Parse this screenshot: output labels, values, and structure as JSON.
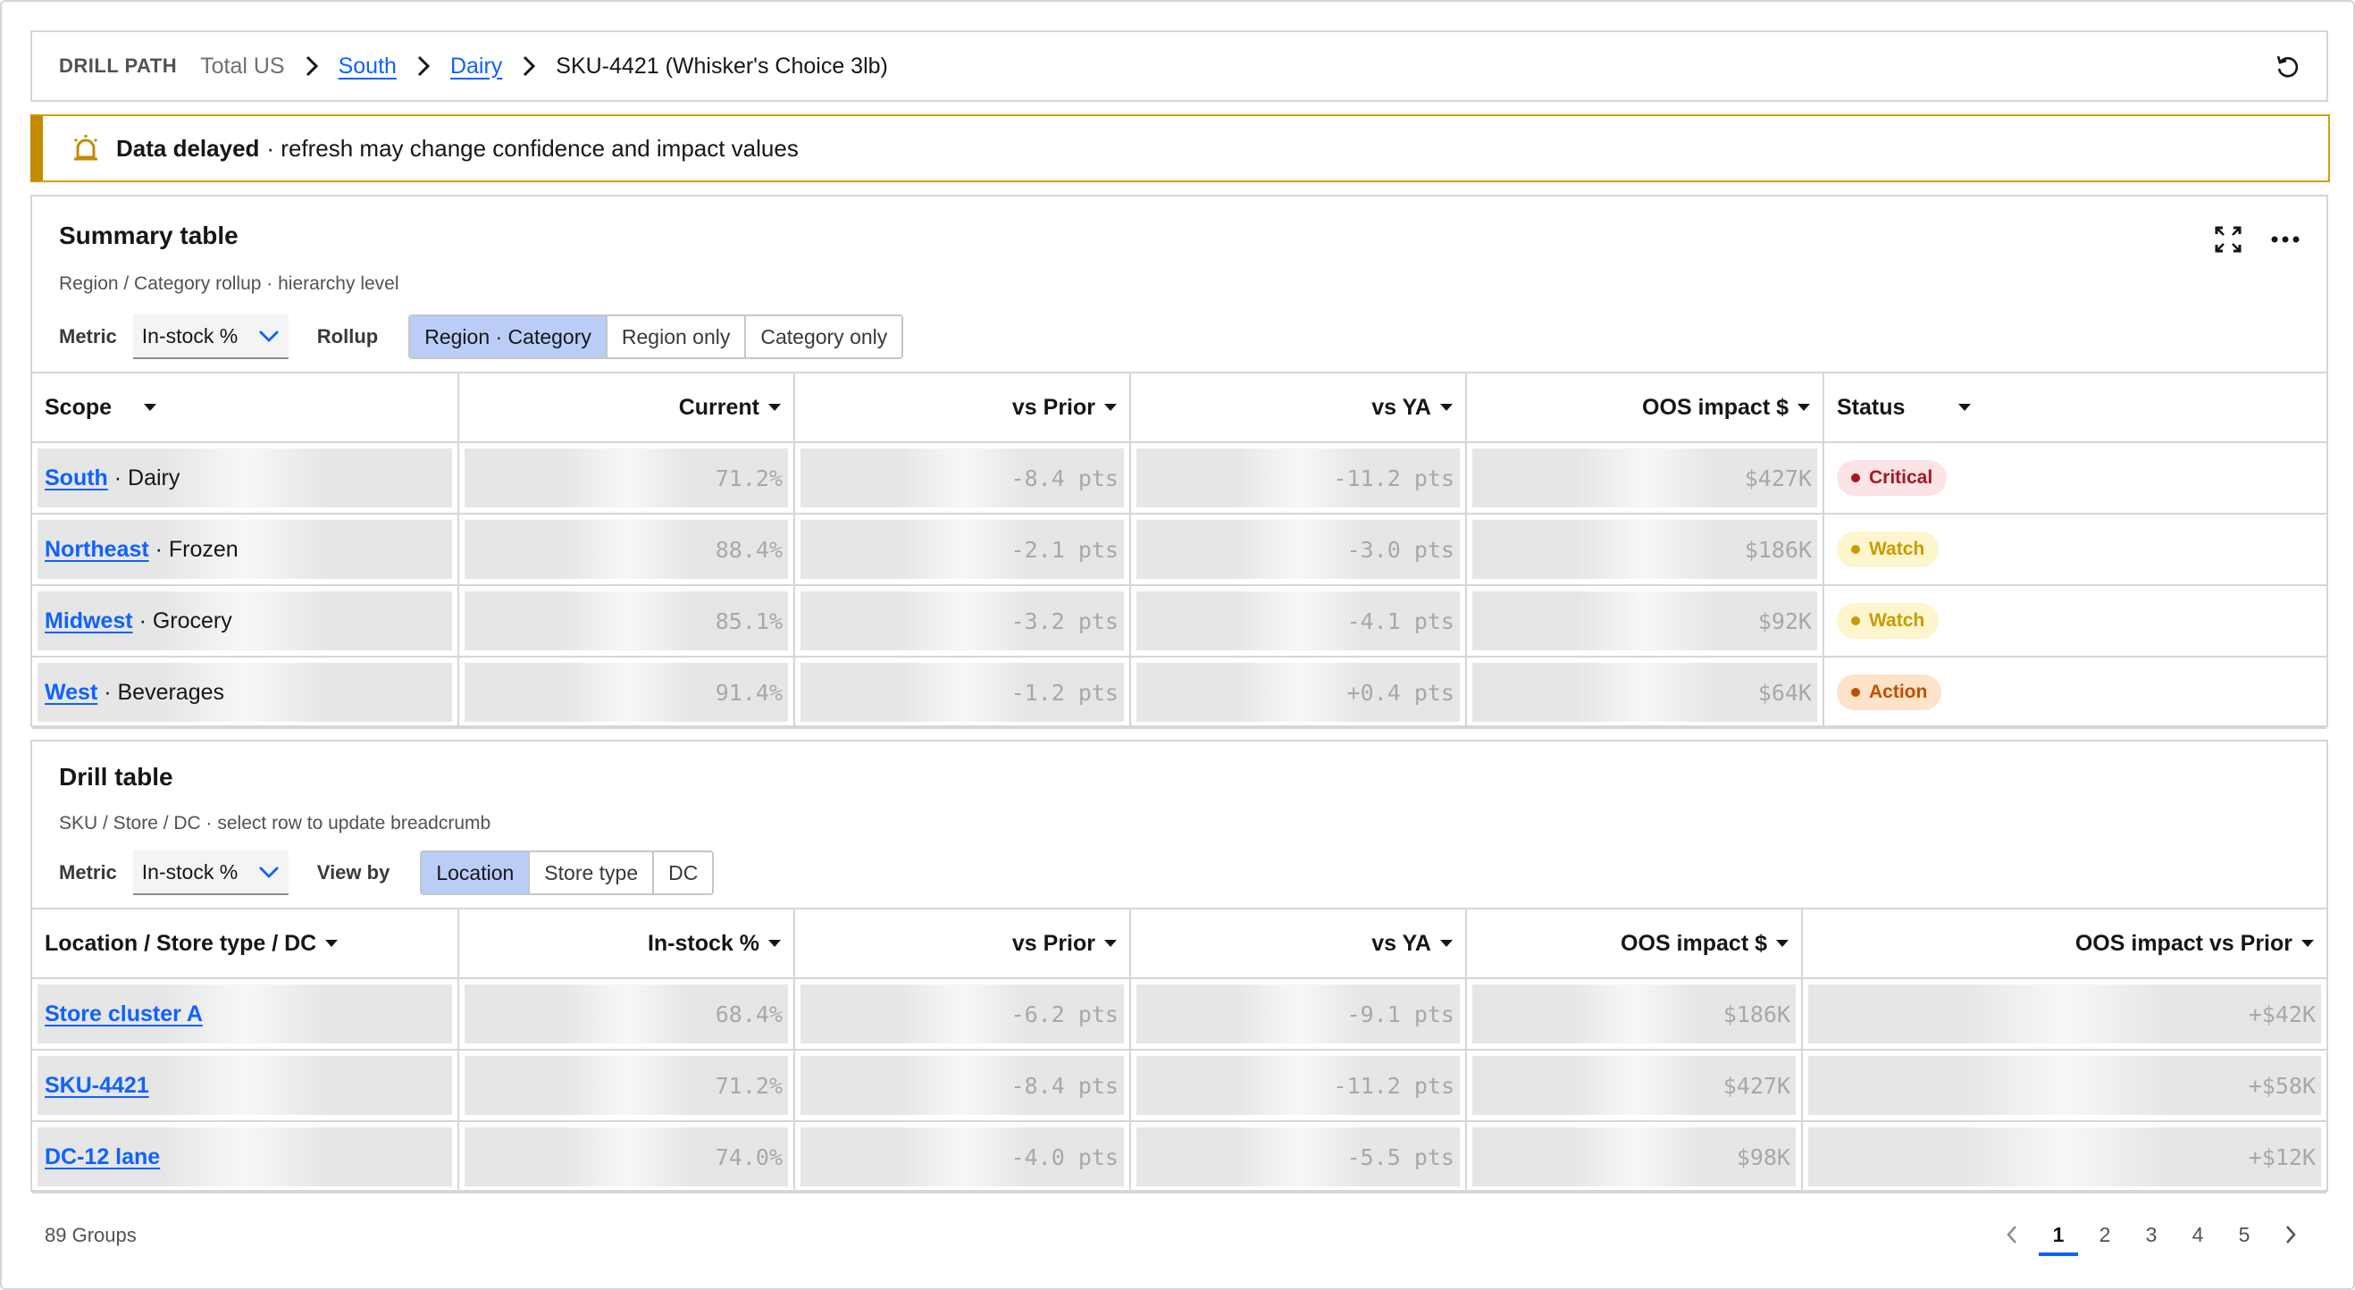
{
  "breadcrumb": {
    "title": "DRILL PATH",
    "items": [
      {
        "label": "Total US"
      },
      {
        "label": "South"
      },
      {
        "label": "Dairy"
      },
      {
        "label": "SKU-4421 (Whisker's Choice 3lb)"
      }
    ]
  },
  "alert": {
    "title": "Data delayed",
    "message": "· refresh may change confidence and impact values",
    "icon": "alarm-bell-icon",
    "color": "#c28b00"
  },
  "summary": {
    "title": "Summary table",
    "subtitle": "Region / Category rollup · hierarchy level",
    "metric_label": "Metric",
    "metric_value": "In-stock %",
    "rollup_label": "Rollup",
    "rollup_options": [
      "Region · Category",
      "Region only",
      "Category only"
    ],
    "columns": [
      "Scope",
      "Current",
      "vs Prior",
      "vs YA",
      "OOS impact $",
      "Status"
    ],
    "rows": [
      {
        "region": "South",
        "category": "Dairy",
        "current": "71.2%",
        "prior": "-8.4 pts",
        "ya": "-11.2 pts",
        "impact": "$427K",
        "status": "Critical"
      },
      {
        "region": "Northeast",
        "category": "Frozen",
        "current": "88.4%",
        "prior": "-2.1 pts",
        "ya": "-3.0 pts",
        "impact": "$186K",
        "status": "Watch"
      },
      {
        "region": "Midwest",
        "category": "Grocery",
        "current": "85.1%",
        "prior": "-3.2 pts",
        "ya": "-4.1 pts",
        "impact": "$92K",
        "status": "Watch"
      },
      {
        "region": "West",
        "category": "Beverages",
        "current": "91.4%",
        "prior": "-1.2 pts",
        "ya": "+0.4 pts",
        "impact": "$64K",
        "status": "Action"
      }
    ]
  },
  "drill": {
    "title": "Drill table",
    "subtitle": "SKU / Store / DC · select row to update breadcrumb",
    "metric_label": "Metric",
    "metric_value": "In-stock %",
    "viewby_label": "View by",
    "viewby_options": [
      "Location",
      "Store type",
      "DC"
    ],
    "columns": [
      "Location / Store type / DC",
      "In-stock %",
      "vs Prior",
      "vs YA",
      "OOS impact $",
      "OOS impact vs Prior"
    ],
    "rows": [
      {
        "location": "Store cluster A",
        "instock": "68.4%",
        "prior": "-6.2 pts",
        "ya": "-9.1 pts",
        "impact": "$186K",
        "impact_prior": "+$42K"
      },
      {
        "location": "SKU-4421",
        "instock": "71.2%",
        "prior": "-8.4 pts",
        "ya": "-11.2 pts",
        "impact": "$427K",
        "impact_prior": "+$58K"
      },
      {
        "location": "DC-12 lane",
        "instock": "74.0%",
        "prior": "-4.0 pts",
        "ya": "-5.5 pts",
        "impact": "$98K",
        "impact_prior": "+$12K"
      }
    ]
  },
  "footer": {
    "count": "89 Groups",
    "pages": [
      "1",
      "2",
      "3",
      "4",
      "5"
    ],
    "current_page": "1"
  },
  "colors": {
    "link": "#0f62fe",
    "critical_bg": "#fbe3e6",
    "critical_fg": "#a2191f",
    "watch_bg": "#fdf5cc",
    "watch_fg": "#c89b00",
    "action_bg": "#fde3c8",
    "action_fg": "#c24e00"
  }
}
